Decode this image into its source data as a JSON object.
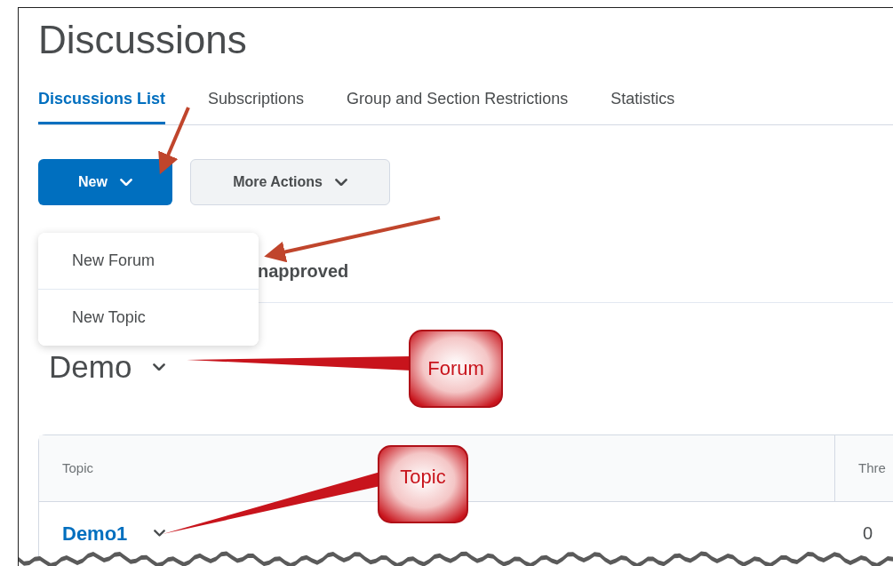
{
  "page": {
    "title": "Discussions"
  },
  "tabs": [
    {
      "label": "Discussions List",
      "selected": true
    },
    {
      "label": "Subscriptions",
      "selected": false
    },
    {
      "label": "Group and Section Restrictions",
      "selected": false
    },
    {
      "label": "Statistics",
      "selected": false
    }
  ],
  "buttons": [
    {
      "label": "New",
      "kind": "primary"
    },
    {
      "label": "More Actions",
      "kind": "secondary"
    }
  ],
  "dropdown_menu": {
    "items": [
      "New Forum",
      "New Topic"
    ]
  },
  "filter_text": "napproved",
  "forum": {
    "title": "Demo"
  },
  "table": {
    "columns": [
      "Topic",
      "Thre"
    ],
    "rows": [
      {
        "topic": "Demo1",
        "column_2": "0"
      }
    ]
  },
  "callouts": [
    {
      "text": "Forum"
    },
    {
      "text": "Topic"
    }
  ]
}
